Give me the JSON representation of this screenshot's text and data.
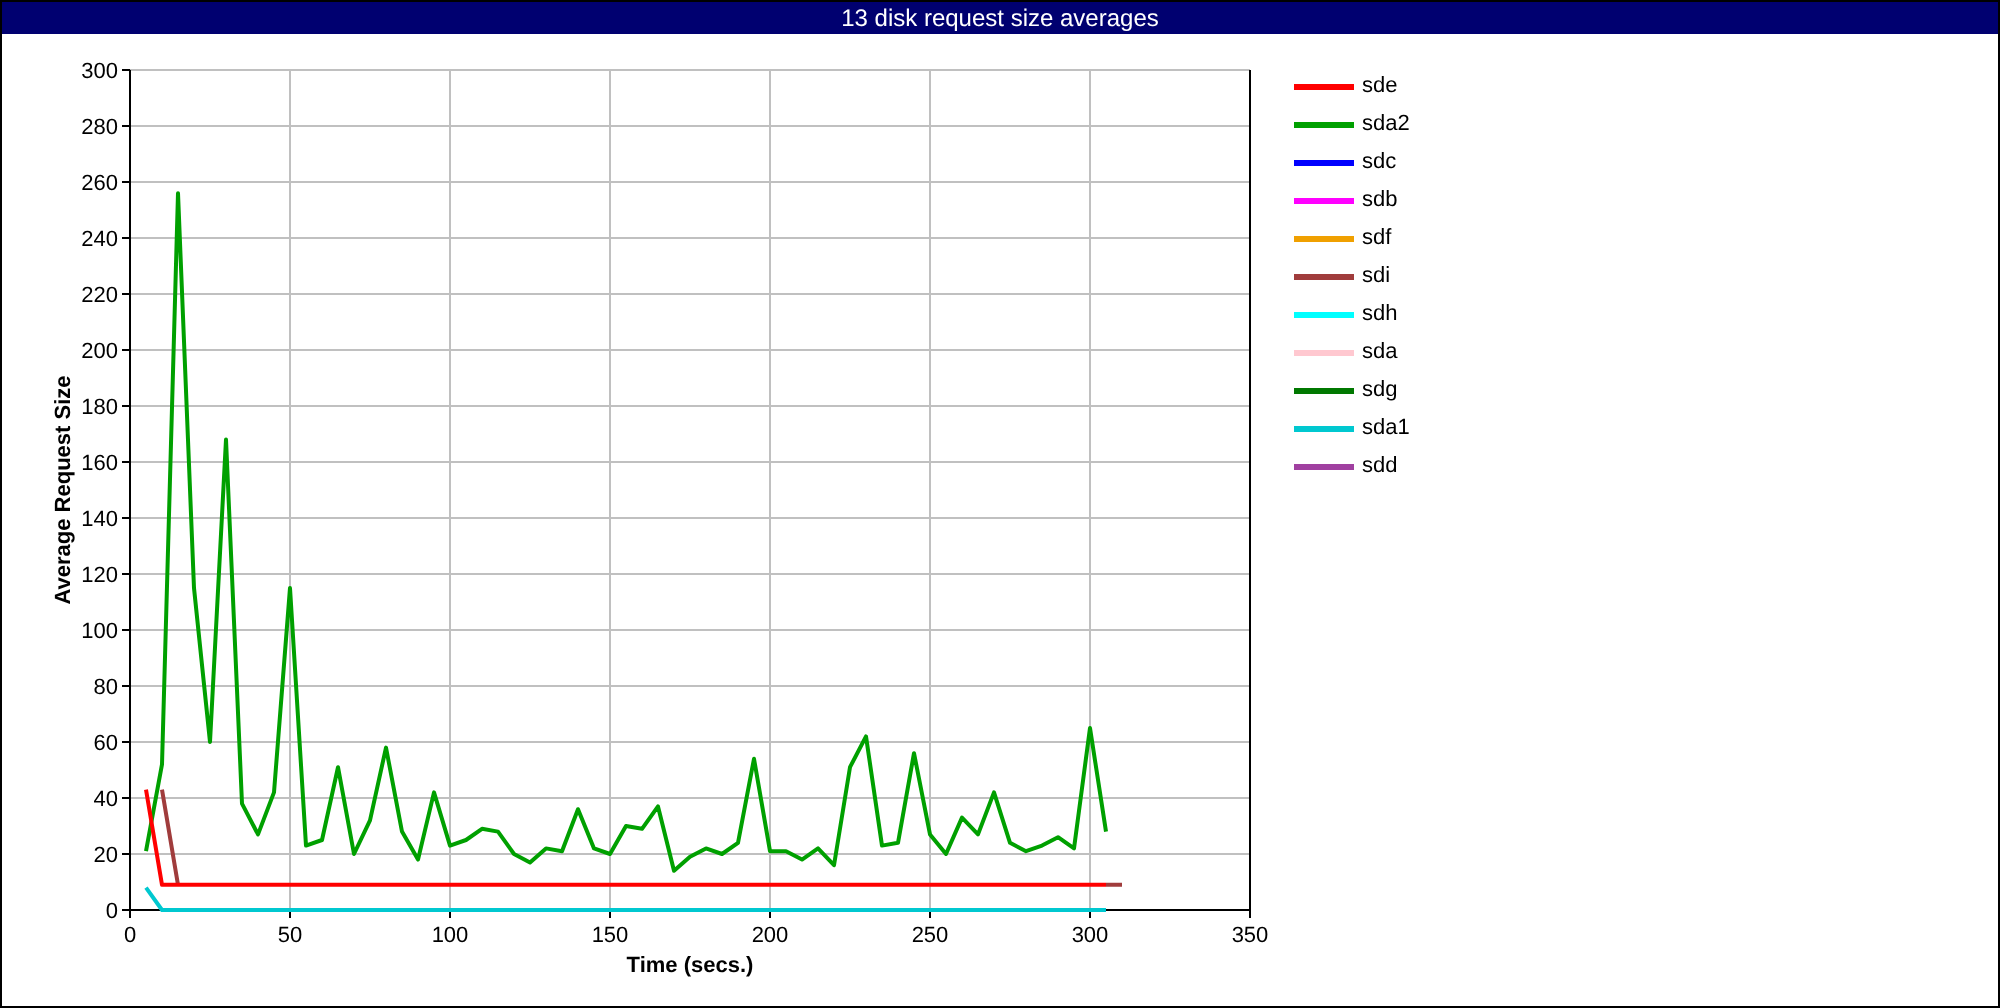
{
  "window": {
    "title": "13 disk request size averages"
  },
  "chart": {
    "chart_data": {
      "type": "line",
      "grid": true,
      "xlabel": "Time (secs.)",
      "ylabel": "Average Request Size",
      "xlim": [
        0,
        350
      ],
      "ylim": [
        0,
        300
      ],
      "xticks": [
        0,
        50,
        100,
        150,
        200,
        250,
        300,
        350
      ],
      "yticks": [
        0,
        20,
        40,
        60,
        80,
        100,
        120,
        140,
        160,
        180,
        200,
        220,
        240,
        260,
        280,
        300
      ],
      "x": [
        5,
        10,
        15,
        20,
        25,
        30,
        35,
        40,
        45,
        50,
        55,
        60,
        65,
        70,
        75,
        80,
        85,
        90,
        95,
        100,
        105,
        110,
        115,
        120,
        125,
        130,
        135,
        140,
        145,
        150,
        155,
        160,
        165,
        170,
        175,
        180,
        185,
        190,
        195,
        200,
        205,
        210,
        215,
        220,
        225,
        230,
        235,
        240,
        245,
        250,
        255,
        260,
        265,
        270,
        275,
        280,
        285,
        290,
        295,
        300,
        305,
        310
      ],
      "series": [
        {
          "name": "sde",
          "color": "#ff0000",
          "values": [
            43,
            9,
            9,
            9,
            9,
            9,
            9,
            9,
            9,
            9,
            9,
            9,
            9,
            9,
            9,
            9,
            9,
            9,
            9,
            9,
            9,
            9,
            9,
            9,
            9,
            9,
            9,
            9,
            9,
            9,
            9,
            9,
            9,
            9,
            9,
            9,
            9,
            9,
            9,
            9,
            9,
            9,
            9,
            9,
            9,
            9,
            9,
            9,
            9,
            9,
            9,
            9,
            9,
            9,
            9,
            9,
            9,
            9,
            9,
            9,
            9,
            null
          ]
        },
        {
          "name": "sda2",
          "color": "#00a000",
          "values": [
            21,
            52,
            256,
            115,
            60,
            168,
            38,
            27,
            42,
            115,
            23,
            25,
            51,
            20,
            32,
            58,
            28,
            18,
            42,
            23,
            25,
            29,
            28,
            20,
            17,
            22,
            21,
            36,
            22,
            20,
            30,
            29,
            37,
            14,
            19,
            22,
            20,
            24,
            54,
            21,
            21,
            18,
            22,
            16,
            51,
            62,
            23,
            24,
            56,
            27,
            20,
            33,
            27,
            42,
            24,
            21,
            23,
            26,
            22,
            65,
            28,
            null
          ]
        },
        {
          "name": "sdc",
          "color": "#0000ff",
          "values": [
            null,
            null,
            null,
            null,
            null,
            null,
            null,
            null,
            null,
            null,
            null,
            null,
            null,
            null,
            null,
            null,
            null,
            null,
            null,
            null,
            null,
            null,
            null,
            null,
            null,
            null,
            null,
            null,
            null,
            null,
            null,
            null,
            null,
            null,
            null,
            null,
            null,
            null,
            null,
            null,
            null,
            null,
            null,
            null,
            null,
            null,
            null,
            null,
            null,
            null,
            null,
            null,
            null,
            null,
            null,
            null,
            null,
            null,
            null,
            null,
            null,
            null
          ]
        },
        {
          "name": "sdb",
          "color": "#ff00ff",
          "values": [
            null,
            null,
            null,
            null,
            null,
            null,
            null,
            null,
            null,
            null,
            null,
            null,
            null,
            null,
            null,
            null,
            null,
            null,
            null,
            null,
            null,
            null,
            null,
            null,
            null,
            null,
            null,
            null,
            null,
            null,
            null,
            null,
            null,
            null,
            null,
            null,
            null,
            null,
            null,
            null,
            null,
            null,
            null,
            null,
            null,
            null,
            null,
            null,
            null,
            null,
            null,
            null,
            null,
            null,
            null,
            null,
            null,
            null,
            null,
            null,
            null,
            null
          ]
        },
        {
          "name": "sdf",
          "color": "#f0a000",
          "values": [
            null,
            null,
            null,
            null,
            null,
            null,
            null,
            null,
            null,
            null,
            null,
            null,
            null,
            null,
            null,
            null,
            null,
            null,
            null,
            null,
            null,
            null,
            null,
            null,
            null,
            null,
            null,
            null,
            null,
            null,
            null,
            null,
            null,
            null,
            null,
            null,
            null,
            null,
            null,
            null,
            null,
            null,
            null,
            null,
            null,
            null,
            null,
            null,
            null,
            null,
            null,
            null,
            null,
            null,
            null,
            null,
            null,
            null,
            null,
            null,
            null,
            null
          ]
        },
        {
          "name": "sdi",
          "color": "#a03c3c",
          "values": [
            null,
            43,
            9,
            null,
            null,
            null,
            null,
            null,
            null,
            null,
            null,
            null,
            null,
            null,
            null,
            null,
            null,
            null,
            null,
            null,
            null,
            null,
            null,
            null,
            null,
            null,
            null,
            null,
            null,
            null,
            null,
            null,
            null,
            null,
            null,
            null,
            null,
            null,
            null,
            null,
            null,
            null,
            null,
            null,
            null,
            null,
            null,
            null,
            null,
            null,
            null,
            null,
            null,
            null,
            null,
            null,
            null,
            null,
            null,
            null,
            9,
            9
          ]
        },
        {
          "name": "sdh",
          "color": "#00ffff",
          "values": [
            null,
            null,
            null,
            null,
            null,
            null,
            null,
            null,
            null,
            null,
            null,
            null,
            null,
            null,
            null,
            null,
            null,
            null,
            null,
            null,
            null,
            null,
            null,
            null,
            null,
            null,
            null,
            null,
            null,
            null,
            null,
            null,
            null,
            null,
            null,
            null,
            null,
            null,
            null,
            null,
            null,
            null,
            null,
            null,
            null,
            null,
            null,
            null,
            null,
            null,
            null,
            null,
            null,
            null,
            null,
            null,
            null,
            null,
            null,
            null,
            null,
            null
          ]
        },
        {
          "name": "sda",
          "color": "#ffc8d0",
          "values": [
            null,
            null,
            null,
            null,
            null,
            null,
            null,
            null,
            null,
            null,
            null,
            null,
            null,
            null,
            null,
            null,
            null,
            null,
            null,
            null,
            null,
            null,
            null,
            null,
            null,
            null,
            null,
            null,
            null,
            null,
            null,
            null,
            null,
            null,
            null,
            null,
            null,
            null,
            null,
            null,
            null,
            null,
            null,
            null,
            null,
            null,
            null,
            null,
            null,
            null,
            null,
            null,
            null,
            null,
            null,
            null,
            null,
            null,
            null,
            null,
            null,
            null
          ]
        },
        {
          "name": "sdg",
          "color": "#007800",
          "values": [
            null,
            null,
            null,
            null,
            null,
            null,
            null,
            null,
            null,
            null,
            null,
            null,
            null,
            null,
            null,
            null,
            null,
            null,
            null,
            null,
            null,
            null,
            null,
            null,
            null,
            null,
            null,
            null,
            null,
            null,
            null,
            null,
            null,
            null,
            null,
            null,
            null,
            null,
            null,
            null,
            null,
            null,
            null,
            null,
            null,
            null,
            null,
            null,
            null,
            null,
            null,
            null,
            null,
            null,
            null,
            null,
            null,
            null,
            null,
            null,
            null,
            null
          ]
        },
        {
          "name": "sda1",
          "color": "#00c8d0",
          "values": [
            8,
            0,
            0,
            0,
            0,
            0,
            0,
            0,
            0,
            0,
            0,
            0,
            0,
            0,
            0,
            0,
            0,
            0,
            0,
            0,
            0,
            0,
            0,
            0,
            0,
            0,
            0,
            0,
            0,
            0,
            0,
            0,
            0,
            0,
            0,
            0,
            0,
            0,
            0,
            0,
            0,
            0,
            0,
            0,
            0,
            0,
            0,
            0,
            0,
            0,
            0,
            0,
            0,
            0,
            0,
            0,
            0,
            0,
            0,
            0,
            0,
            null
          ]
        },
        {
          "name": "sdd",
          "color": "#a040a0",
          "values": [
            null,
            null,
            null,
            null,
            null,
            null,
            null,
            null,
            null,
            null,
            null,
            null,
            null,
            null,
            null,
            null,
            null,
            null,
            null,
            null,
            null,
            null,
            null,
            null,
            null,
            null,
            null,
            null,
            null,
            null,
            null,
            null,
            null,
            null,
            null,
            null,
            null,
            null,
            null,
            null,
            null,
            null,
            null,
            null,
            null,
            null,
            null,
            null,
            null,
            null,
            null,
            null,
            null,
            null,
            null,
            null,
            null,
            null,
            null,
            null,
            null,
            null
          ]
        }
      ]
    }
  }
}
